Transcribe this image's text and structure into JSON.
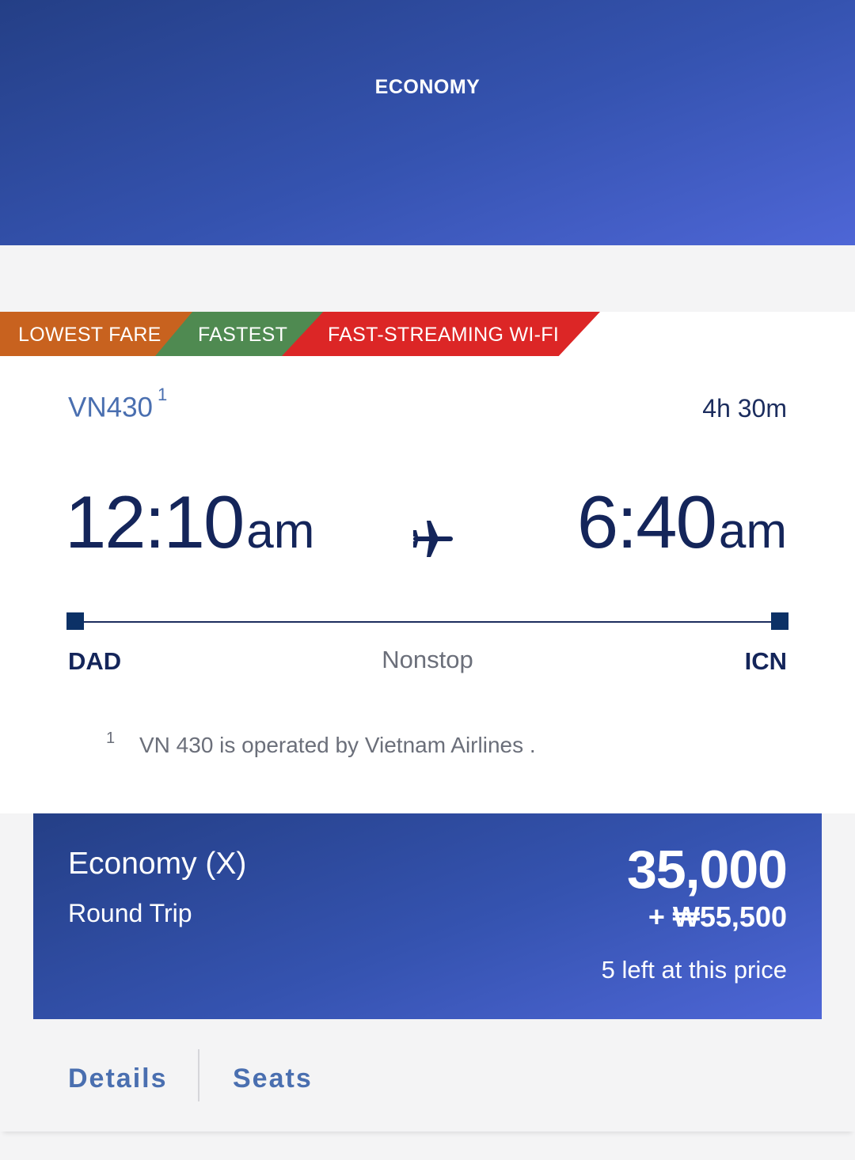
{
  "header": {
    "title": "ECONOMY"
  },
  "tags": [
    "LOWEST FARE",
    "FASTEST",
    "FAST-STREAMING WI-FI"
  ],
  "flight": {
    "number": "VN430",
    "footnote_ref": "1",
    "duration": "4h 30m",
    "departure": {
      "time": "12:10",
      "period": "am",
      "airport": "DAD"
    },
    "arrival": {
      "time": "6:40",
      "period": "am",
      "airport": "ICN"
    },
    "stops": "Nonstop",
    "footnote": {
      "marker": "1",
      "text": "VN 430 is operated by Vietnam Airlines ."
    }
  },
  "fare": {
    "class": "Economy (X)",
    "trip_type": "Round Trip",
    "miles": "35,000",
    "cash": "+ ₩55,500",
    "availability": "5 left at this price"
  },
  "actions": {
    "details": "Details",
    "seats": "Seats"
  },
  "colors": {
    "header_gradient_start": "#243f86",
    "header_gradient_end": "#4e66d6",
    "tag_lowest": "#c8621f",
    "tag_fastest": "#4f8a51",
    "tag_wifi": "#dc2626",
    "text_dark": "#14255a",
    "link": "#4a6fb0"
  }
}
